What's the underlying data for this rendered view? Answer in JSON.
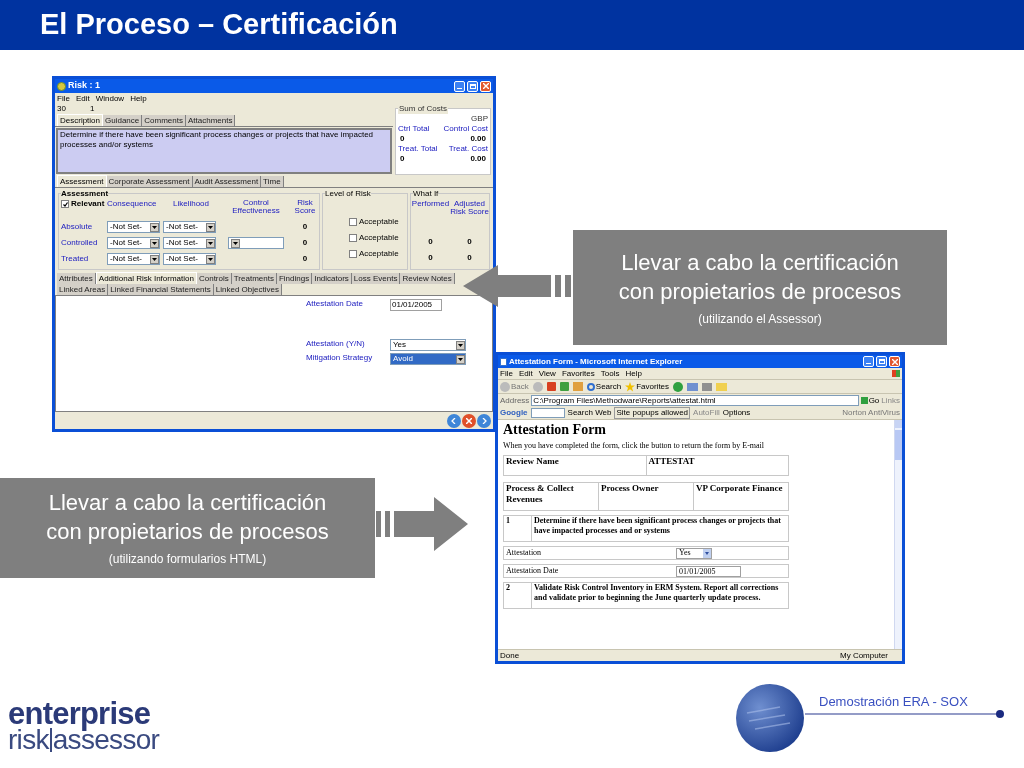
{
  "slide_title": "El Proceso – Certificación",
  "risk_window": {
    "title": "Risk : 1",
    "menu": [
      "File",
      "Edit",
      "Window",
      "Help"
    ],
    "id_fields": [
      "30",
      "1"
    ],
    "desc_tabs": [
      {
        "label": "Description",
        "selected": true
      },
      {
        "label": "Guidance",
        "selected": false
      },
      {
        "label": "Comments",
        "selected": false
      },
      {
        "label": "Attachments",
        "selected": false
      }
    ],
    "description": "Determine if there have been significant process changes or projects that have impacted processes and/or systems",
    "sum_of_costs": {
      "title": "Sum of Costs",
      "currency": "GBP",
      "items": [
        {
          "label": "Ctrl Total",
          "value": "0"
        },
        {
          "label": "Control Cost",
          "value": "0.00"
        },
        {
          "label": "Treat. Total",
          "value": "0"
        },
        {
          "label": "Treat. Cost",
          "value": "0.00"
        }
      ]
    },
    "assessment_tabs": [
      {
        "label": "Assessment",
        "selected": true
      },
      {
        "label": "Corporate Assessment",
        "selected": false
      },
      {
        "label": "Audit Assessment",
        "selected": false
      },
      {
        "label": "Time",
        "selected": false
      }
    ],
    "assessment": {
      "title": "Assessment",
      "relevant": {
        "label": "Relevant",
        "checked": true
      },
      "columns": [
        "Consequence",
        "Likelihood",
        "Control Effectiveness",
        "Risk Score"
      ],
      "rows": [
        {
          "label": "Absolute",
          "consequence": "-Not Set-",
          "likelihood": "-Not Set-",
          "effectiveness_field": false,
          "risk_score": "0"
        },
        {
          "label": "Controlled",
          "consequence": "-Not Set-",
          "likelihood": "-Not Set-",
          "effectiveness_field": true,
          "risk_score": "0"
        },
        {
          "label": "Treated",
          "consequence": "-Not Set-",
          "likelihood": "-Not Set-",
          "effectiveness_field": false,
          "risk_score": "0"
        }
      ]
    },
    "level_of_risk": {
      "title": "Level of Risk",
      "rows": [
        {
          "label": "Acceptable",
          "checked": false
        },
        {
          "label": "Acceptable",
          "checked": false
        },
        {
          "label": "Acceptable",
          "checked": false
        }
      ]
    },
    "what_if": {
      "title": "What If",
      "columns": [
        "Performed",
        "Adjusted Risk Score"
      ],
      "rows": [
        {
          "performed": "0",
          "adjusted": "0"
        },
        {
          "performed": "0",
          "adjusted": "0"
        }
      ]
    },
    "detail_tabs": [
      {
        "label": "Attributes",
        "selected": false
      },
      {
        "label": "Additional Risk Information",
        "selected": true
      },
      {
        "label": "Controls",
        "selected": false
      },
      {
        "label": "Treatments",
        "selected": false
      },
      {
        "label": "Findings",
        "selected": false
      },
      {
        "label": "Indicators",
        "selected": false
      },
      {
        "label": "Loss Events",
        "selected": false
      },
      {
        "label": "Review Notes",
        "selected": false
      },
      {
        "label": "Linked Areas",
        "selected": false
      },
      {
        "label": "Linked Financial Statements",
        "selected": false
      },
      {
        "label": "Linked Objectives",
        "selected": false
      }
    ],
    "fields": [
      {
        "label": "Attestation Date",
        "kind": "text",
        "value": "01/01/2005",
        "highlighted": false
      },
      {
        "label": "Attestation (Y/N)",
        "kind": "select",
        "value": "Yes",
        "highlighted": false
      },
      {
        "label": "Mitigation Strategy",
        "kind": "select",
        "value": "Avoid",
        "highlighted": true
      }
    ]
  },
  "callouts": [
    {
      "lines": [
        "Llevar a cabo la certificación",
        "con propietarios de procesos"
      ],
      "note": "(utilizando el Assessor)"
    },
    {
      "lines": [
        "Llevar a cabo la certificación",
        "con propietarios de procesos"
      ],
      "note": "(utilizando formularios HTML)"
    }
  ],
  "browser": {
    "title": "Attestation Form - Microsoft Internet Explorer",
    "menu": [
      "File",
      "Edit",
      "View",
      "Favorites",
      "Tools",
      "Help"
    ],
    "toolbar": {
      "back": "Back",
      "search": "Search",
      "favorites": "Favorites"
    },
    "address_label": "Address",
    "address": "C:\\Program Files\\Methodware\\Reports\\attestat.html",
    "go": "Go",
    "links": "Links",
    "google_bar": {
      "logo": "Google",
      "search_web": "Search Web",
      "popups": "Site popups allowed",
      "autofill": "AutoFill",
      "options": "Options",
      "norton": "Norton AntiVirus"
    },
    "page": {
      "heading": "Attestation Form",
      "intro": "When you have completed the form, click the button to return the form by E-mail",
      "review": [
        "Review Name",
        "ATTESTAT"
      ],
      "process": [
        "Process & Collect Revenues",
        "Process Owner",
        "VP Corporate Finance"
      ],
      "blocks": [
        {
          "kind": "question",
          "number": "1",
          "text": "Determine if there have been significant process changes or projects that have impacted processes and or systems"
        },
        {
          "kind": "select",
          "label": "Attestation",
          "value": "Yes"
        },
        {
          "kind": "date",
          "label": "Attestation Date",
          "value": "01/01/2005"
        },
        {
          "kind": "question",
          "number": "2",
          "text": "Validate Risk Control Inventory in ERM System. Report all corrections and validate prior to beginning the June quarterly update process."
        }
      ]
    },
    "status": "Done",
    "zone": "My Computer"
  },
  "footer": {
    "logo_top": "enterprise",
    "logo_left": "risk",
    "logo_right": "assessor",
    "caption": "Demostración ERA - SOX"
  }
}
